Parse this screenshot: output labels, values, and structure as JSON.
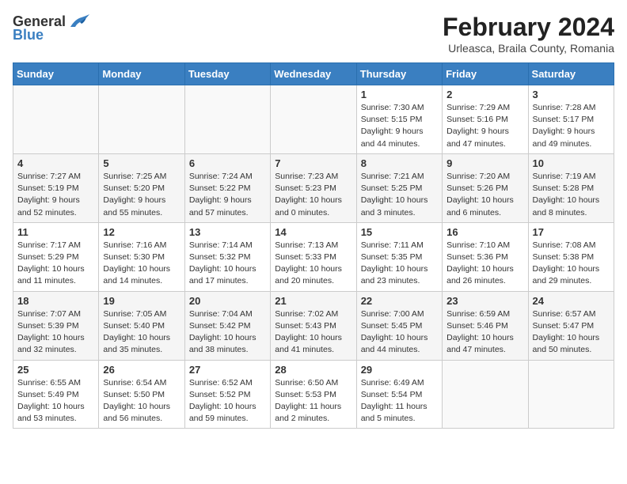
{
  "header": {
    "logo_general": "General",
    "logo_blue": "Blue",
    "title": "February 2024",
    "subtitle": "Urleasca, Braila County, Romania"
  },
  "days_of_week": [
    "Sunday",
    "Monday",
    "Tuesday",
    "Wednesday",
    "Thursday",
    "Friday",
    "Saturday"
  ],
  "weeks": [
    [
      {
        "day": "",
        "info": ""
      },
      {
        "day": "",
        "info": ""
      },
      {
        "day": "",
        "info": ""
      },
      {
        "day": "",
        "info": ""
      },
      {
        "day": "1",
        "info": "Sunrise: 7:30 AM\nSunset: 5:15 PM\nDaylight: 9 hours and 44 minutes."
      },
      {
        "day": "2",
        "info": "Sunrise: 7:29 AM\nSunset: 5:16 PM\nDaylight: 9 hours and 47 minutes."
      },
      {
        "day": "3",
        "info": "Sunrise: 7:28 AM\nSunset: 5:17 PM\nDaylight: 9 hours and 49 minutes."
      }
    ],
    [
      {
        "day": "4",
        "info": "Sunrise: 7:27 AM\nSunset: 5:19 PM\nDaylight: 9 hours and 52 minutes."
      },
      {
        "day": "5",
        "info": "Sunrise: 7:25 AM\nSunset: 5:20 PM\nDaylight: 9 hours and 55 minutes."
      },
      {
        "day": "6",
        "info": "Sunrise: 7:24 AM\nSunset: 5:22 PM\nDaylight: 9 hours and 57 minutes."
      },
      {
        "day": "7",
        "info": "Sunrise: 7:23 AM\nSunset: 5:23 PM\nDaylight: 10 hours and 0 minutes."
      },
      {
        "day": "8",
        "info": "Sunrise: 7:21 AM\nSunset: 5:25 PM\nDaylight: 10 hours and 3 minutes."
      },
      {
        "day": "9",
        "info": "Sunrise: 7:20 AM\nSunset: 5:26 PM\nDaylight: 10 hours and 6 minutes."
      },
      {
        "day": "10",
        "info": "Sunrise: 7:19 AM\nSunset: 5:28 PM\nDaylight: 10 hours and 8 minutes."
      }
    ],
    [
      {
        "day": "11",
        "info": "Sunrise: 7:17 AM\nSunset: 5:29 PM\nDaylight: 10 hours and 11 minutes."
      },
      {
        "day": "12",
        "info": "Sunrise: 7:16 AM\nSunset: 5:30 PM\nDaylight: 10 hours and 14 minutes."
      },
      {
        "day": "13",
        "info": "Sunrise: 7:14 AM\nSunset: 5:32 PM\nDaylight: 10 hours and 17 minutes."
      },
      {
        "day": "14",
        "info": "Sunrise: 7:13 AM\nSunset: 5:33 PM\nDaylight: 10 hours and 20 minutes."
      },
      {
        "day": "15",
        "info": "Sunrise: 7:11 AM\nSunset: 5:35 PM\nDaylight: 10 hours and 23 minutes."
      },
      {
        "day": "16",
        "info": "Sunrise: 7:10 AM\nSunset: 5:36 PM\nDaylight: 10 hours and 26 minutes."
      },
      {
        "day": "17",
        "info": "Sunrise: 7:08 AM\nSunset: 5:38 PM\nDaylight: 10 hours and 29 minutes."
      }
    ],
    [
      {
        "day": "18",
        "info": "Sunrise: 7:07 AM\nSunset: 5:39 PM\nDaylight: 10 hours and 32 minutes."
      },
      {
        "day": "19",
        "info": "Sunrise: 7:05 AM\nSunset: 5:40 PM\nDaylight: 10 hours and 35 minutes."
      },
      {
        "day": "20",
        "info": "Sunrise: 7:04 AM\nSunset: 5:42 PM\nDaylight: 10 hours and 38 minutes."
      },
      {
        "day": "21",
        "info": "Sunrise: 7:02 AM\nSunset: 5:43 PM\nDaylight: 10 hours and 41 minutes."
      },
      {
        "day": "22",
        "info": "Sunrise: 7:00 AM\nSunset: 5:45 PM\nDaylight: 10 hours and 44 minutes."
      },
      {
        "day": "23",
        "info": "Sunrise: 6:59 AM\nSunset: 5:46 PM\nDaylight: 10 hours and 47 minutes."
      },
      {
        "day": "24",
        "info": "Sunrise: 6:57 AM\nSunset: 5:47 PM\nDaylight: 10 hours and 50 minutes."
      }
    ],
    [
      {
        "day": "25",
        "info": "Sunrise: 6:55 AM\nSunset: 5:49 PM\nDaylight: 10 hours and 53 minutes."
      },
      {
        "day": "26",
        "info": "Sunrise: 6:54 AM\nSunset: 5:50 PM\nDaylight: 10 hours and 56 minutes."
      },
      {
        "day": "27",
        "info": "Sunrise: 6:52 AM\nSunset: 5:52 PM\nDaylight: 10 hours and 59 minutes."
      },
      {
        "day": "28",
        "info": "Sunrise: 6:50 AM\nSunset: 5:53 PM\nDaylight: 11 hours and 2 minutes."
      },
      {
        "day": "29",
        "info": "Sunrise: 6:49 AM\nSunset: 5:54 PM\nDaylight: 11 hours and 5 minutes."
      },
      {
        "day": "",
        "info": ""
      },
      {
        "day": "",
        "info": ""
      }
    ]
  ]
}
